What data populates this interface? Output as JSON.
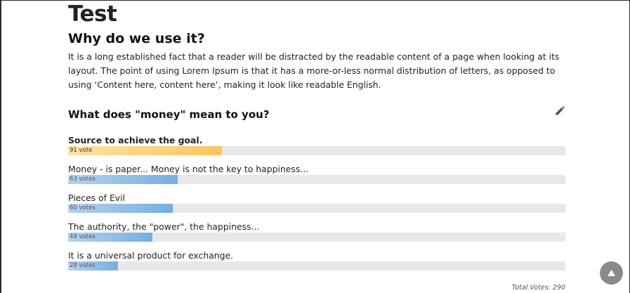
{
  "page": {
    "title": "Test",
    "section_title": "Why do we use it?",
    "paragraph": "It is a long established fact that a reader will be distracted by the readable content of a page when looking at its layout. The point of using Lorem Ipsum is that it has a more-or-less normal distribution of letters, as opposed to using ‘Content here, content here’, making it look like readable English."
  },
  "poll": {
    "question": "What does \"money\" mean to you?",
    "options": [
      {
        "label": "Source to achieve the goal.",
        "votes": 91,
        "votes_label": "91 vote",
        "share": 0.31
      },
      {
        "label": "Money - is paper... Money is not the key to happiness...",
        "votes": 63,
        "votes_label": "63 votes",
        "share": 0.22
      },
      {
        "label": "Pieces of Evil",
        "votes": 60,
        "votes_label": "60 votes",
        "share": 0.21
      },
      {
        "label": "The authority, the \"power\", the happiness...",
        "votes": 48,
        "votes_label": "48 votes",
        "share": 0.17
      },
      {
        "label": "It is a universal product for exchange.",
        "votes": 28,
        "votes_label": "28 votes",
        "share": 0.1
      }
    ],
    "total_votes": "Total Votes: 290"
  },
  "colors": {
    "winner_bar": "#fcc560",
    "bar": "#76aee0",
    "track": "#e8e8e8",
    "scroll_button": "#8a8a8a"
  },
  "icons": {
    "edit": "pencil-icon",
    "scroll_top": "triangle-up-icon"
  }
}
